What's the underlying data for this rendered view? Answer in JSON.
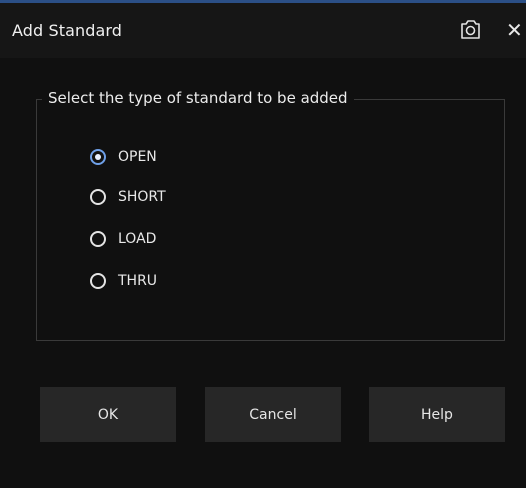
{
  "window": {
    "title": "Add Standard",
    "icons": [
      "camera-icon",
      "close-icon"
    ],
    "close_glyph": "✕"
  },
  "group": {
    "legend": "Select the type of standard to be added",
    "options": [
      {
        "label": "OPEN",
        "checked": true
      },
      {
        "label": "SHORT",
        "checked": false
      },
      {
        "label": "LOAD",
        "checked": false
      },
      {
        "label": "THRU",
        "checked": false
      }
    ]
  },
  "buttons": {
    "ok": "OK",
    "cancel": "Cancel",
    "help": "Help"
  },
  "colors": {
    "accent": "#6fa0e8",
    "title_accent_line": "#2b4f86",
    "background": "#101010",
    "button": "#272727"
  }
}
